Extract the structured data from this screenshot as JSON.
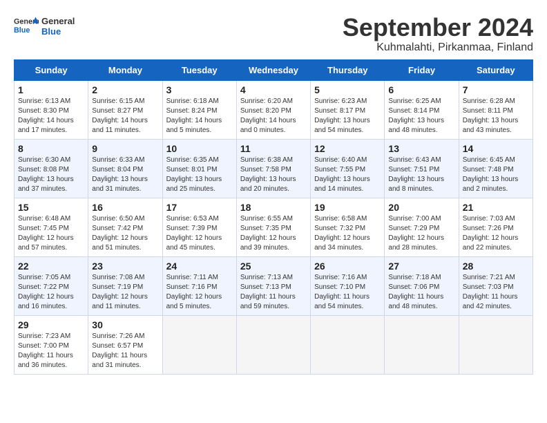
{
  "header": {
    "logo_general": "General",
    "logo_blue": "Blue",
    "month_title": "September 2024",
    "location": "Kuhmalahti, Pirkanmaa, Finland"
  },
  "days_of_week": [
    "Sunday",
    "Monday",
    "Tuesday",
    "Wednesday",
    "Thursday",
    "Friday",
    "Saturday"
  ],
  "weeks": [
    [
      {
        "day": 1,
        "sunrise": "6:13 AM",
        "sunset": "8:30 PM",
        "daylight": "14 hours and 17 minutes."
      },
      {
        "day": 2,
        "sunrise": "6:15 AM",
        "sunset": "8:27 PM",
        "daylight": "14 hours and 11 minutes."
      },
      {
        "day": 3,
        "sunrise": "6:18 AM",
        "sunset": "8:24 PM",
        "daylight": "14 hours and 5 minutes."
      },
      {
        "day": 4,
        "sunrise": "6:20 AM",
        "sunset": "8:20 PM",
        "daylight": "14 hours and 0 minutes."
      },
      {
        "day": 5,
        "sunrise": "6:23 AM",
        "sunset": "8:17 PM",
        "daylight": "13 hours and 54 minutes."
      },
      {
        "day": 6,
        "sunrise": "6:25 AM",
        "sunset": "8:14 PM",
        "daylight": "13 hours and 48 minutes."
      },
      {
        "day": 7,
        "sunrise": "6:28 AM",
        "sunset": "8:11 PM",
        "daylight": "13 hours and 43 minutes."
      }
    ],
    [
      {
        "day": 8,
        "sunrise": "6:30 AM",
        "sunset": "8:08 PM",
        "daylight": "13 hours and 37 minutes."
      },
      {
        "day": 9,
        "sunrise": "6:33 AM",
        "sunset": "8:04 PM",
        "daylight": "13 hours and 31 minutes."
      },
      {
        "day": 10,
        "sunrise": "6:35 AM",
        "sunset": "8:01 PM",
        "daylight": "13 hours and 25 minutes."
      },
      {
        "day": 11,
        "sunrise": "6:38 AM",
        "sunset": "7:58 PM",
        "daylight": "13 hours and 20 minutes."
      },
      {
        "day": 12,
        "sunrise": "6:40 AM",
        "sunset": "7:55 PM",
        "daylight": "13 hours and 14 minutes."
      },
      {
        "day": 13,
        "sunrise": "6:43 AM",
        "sunset": "7:51 PM",
        "daylight": "13 hours and 8 minutes."
      },
      {
        "day": 14,
        "sunrise": "6:45 AM",
        "sunset": "7:48 PM",
        "daylight": "13 hours and 2 minutes."
      }
    ],
    [
      {
        "day": 15,
        "sunrise": "6:48 AM",
        "sunset": "7:45 PM",
        "daylight": "12 hours and 57 minutes."
      },
      {
        "day": 16,
        "sunrise": "6:50 AM",
        "sunset": "7:42 PM",
        "daylight": "12 hours and 51 minutes."
      },
      {
        "day": 17,
        "sunrise": "6:53 AM",
        "sunset": "7:39 PM",
        "daylight": "12 hours and 45 minutes."
      },
      {
        "day": 18,
        "sunrise": "6:55 AM",
        "sunset": "7:35 PM",
        "daylight": "12 hours and 39 minutes."
      },
      {
        "day": 19,
        "sunrise": "6:58 AM",
        "sunset": "7:32 PM",
        "daylight": "12 hours and 34 minutes."
      },
      {
        "day": 20,
        "sunrise": "7:00 AM",
        "sunset": "7:29 PM",
        "daylight": "12 hours and 28 minutes."
      },
      {
        "day": 21,
        "sunrise": "7:03 AM",
        "sunset": "7:26 PM",
        "daylight": "12 hours and 22 minutes."
      }
    ],
    [
      {
        "day": 22,
        "sunrise": "7:05 AM",
        "sunset": "7:22 PM",
        "daylight": "12 hours and 16 minutes."
      },
      {
        "day": 23,
        "sunrise": "7:08 AM",
        "sunset": "7:19 PM",
        "daylight": "12 hours and 11 minutes."
      },
      {
        "day": 24,
        "sunrise": "7:11 AM",
        "sunset": "7:16 PM",
        "daylight": "12 hours and 5 minutes."
      },
      {
        "day": 25,
        "sunrise": "7:13 AM",
        "sunset": "7:13 PM",
        "daylight": "11 hours and 59 minutes."
      },
      {
        "day": 26,
        "sunrise": "7:16 AM",
        "sunset": "7:10 PM",
        "daylight": "11 hours and 54 minutes."
      },
      {
        "day": 27,
        "sunrise": "7:18 AM",
        "sunset": "7:06 PM",
        "daylight": "11 hours and 48 minutes."
      },
      {
        "day": 28,
        "sunrise": "7:21 AM",
        "sunset": "7:03 PM",
        "daylight": "11 hours and 42 minutes."
      }
    ],
    [
      {
        "day": 29,
        "sunrise": "7:23 AM",
        "sunset": "7:00 PM",
        "daylight": "11 hours and 36 minutes."
      },
      {
        "day": 30,
        "sunrise": "7:26 AM",
        "sunset": "6:57 PM",
        "daylight": "11 hours and 31 minutes."
      },
      null,
      null,
      null,
      null,
      null
    ]
  ]
}
